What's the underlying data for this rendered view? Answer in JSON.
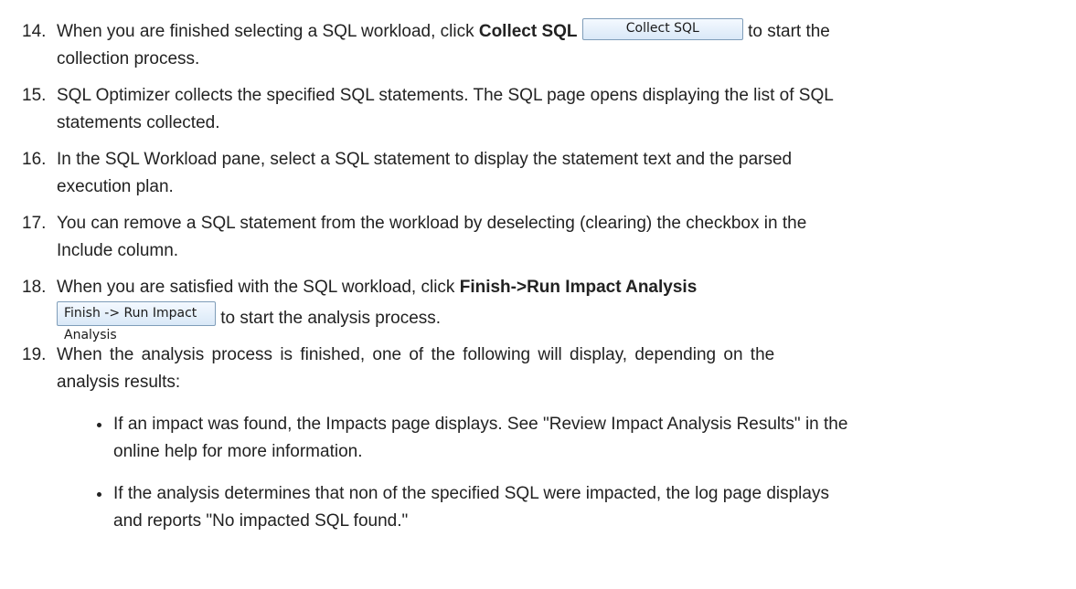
{
  "steps": [
    {
      "num": "14.",
      "pre": "When you are finished selecting a SQL workload, click ",
      "bold": "Collect SQL",
      "button": "Collect SQL",
      "post": " to start the",
      "line2": "collection process."
    },
    {
      "num": "15.",
      "line1": "SQL Optimizer collects the specified SQL statements. The SQL page opens displaying the list of SQL",
      "line2": "statements collected."
    },
    {
      "num": "16.",
      "line1": "In the SQL Workload pane, select a SQL statement to display the statement text and the parsed",
      "line2": "execution plan."
    },
    {
      "num": "17.",
      "line1": "You can remove a SQL statement from the workload by deselecting (clearing) the checkbox in the",
      "line2": "Include column."
    },
    {
      "num": "18.",
      "pre": "When you are satisfied with the SQL workload, click ",
      "bold": "Finish->Run Impact Analysis",
      "button": "Finish -> Run Impact Analysis",
      "post": " to start the analysis process."
    },
    {
      "num": "19.",
      "line1": "When the analysis process is finished, one of the following will display, depending on the",
      "line2": "analysis results:",
      "bullets": [
        {
          "line1": "If an impact was found, the Impacts page displays. See \"Review Impact Analysis Results\" in the",
          "line2": "online help for more information."
        },
        {
          "line1": "If the analysis determines that non of the specified SQL were impacted, the log page displays",
          "line2": "and reports \"No impacted SQL found.\""
        }
      ]
    }
  ]
}
